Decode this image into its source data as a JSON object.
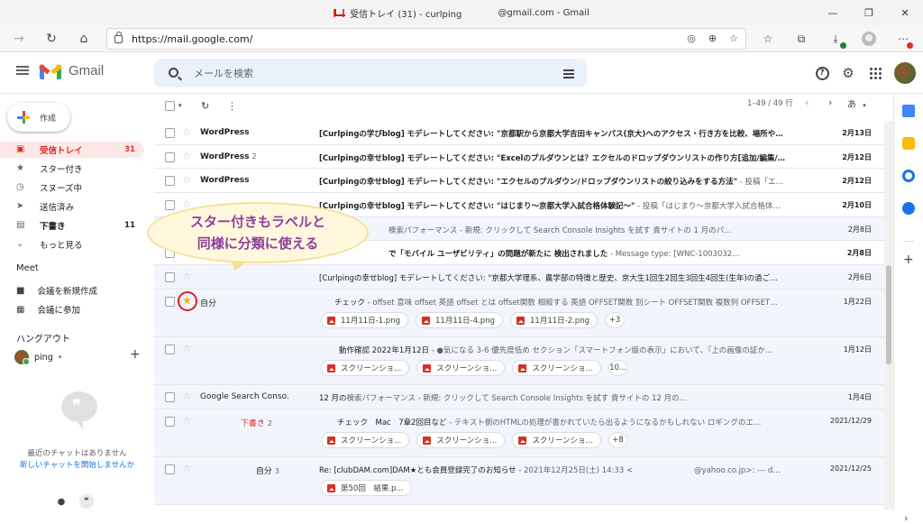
{
  "browser": {
    "window_title_part1": "受信トレイ (31) - curlping",
    "window_title_part2": "@gmail.com - Gmail",
    "url": "https://mail.google.com/"
  },
  "gmail": {
    "brand": "Gmail",
    "search_placeholder": "メールを検索"
  },
  "sidebar": {
    "compose": "作成",
    "items": [
      {
        "label": "受信トレイ",
        "count": "31",
        "icon": "inbox-icon"
      },
      {
        "label": "スター付き",
        "count": "",
        "icon": "star-icon"
      },
      {
        "label": "スヌーズ中",
        "count": "",
        "icon": "clock-icon"
      },
      {
        "label": "送信済み",
        "count": "",
        "icon": "send-icon"
      },
      {
        "label": "下書き",
        "count": "11",
        "icon": "draft-icon"
      },
      {
        "label": "もっと見る",
        "count": "",
        "icon": "expand-icon"
      }
    ],
    "meet_title": "Meet",
    "meet_items": [
      "会議を新規作成",
      "会議に参加"
    ],
    "hangouts_title": "ハングアウト",
    "hangouts_user": "ping",
    "no_chats": "最近のチャットはありません",
    "start_chat": "新しいチャットを開始しませんか"
  },
  "toolbar": {
    "pager": "1–49 / 49 行",
    "lang": "あ"
  },
  "emails": [
    {
      "sender": "WordPress",
      "count": "",
      "draft": "",
      "subject": "[Curlpingの学びblog] モデレートしてください: \"京都駅から京都大学吉田キャンパス(京大)へのアクセス・行き方を比較、場所や…",
      "snippet": "",
      "date": "2月13日",
      "unread": true,
      "starred": false
    },
    {
      "sender": "WordPress",
      "count": "2",
      "draft": "",
      "subject": "[Curlpingの幸せblog] モデレートしてください: \"Excelのプルダウンとは？エクセルのドロップダウンリストの作り方[追加/編集/…",
      "snippet": "",
      "date": "2月12日",
      "unread": true,
      "starred": false
    },
    {
      "sender": "WordPress",
      "count": "",
      "draft": "",
      "subject": "[Curlpingの幸せblog] モデレートしてください: \"エクセルのプルダウン/ドロップダウンリストの絞り込みをする方法\"",
      "snippet": " - 投稿「エ…",
      "date": "2月12日",
      "unread": true,
      "starred": false
    },
    {
      "sender": "",
      "count": "",
      "draft": "",
      "subject": "[Curlpingの幸せblog] モデレートしてください: \"はじまり〜京都大学入試合格体験記〜\"",
      "snippet": " - 投稿「はじまり〜京都大学入試合格体…",
      "date": "2月10日",
      "unread": true,
      "starred": false
    },
    {
      "sender": "",
      "count": "",
      "draft": "",
      "subject": "",
      "snippet": "検索パフォーマンス - 新規: クリックして Search Console Insights を試す 貴サイトの 1 月のパ…",
      "date": "2月8日",
      "unread": false,
      "starred": false
    },
    {
      "sender": "",
      "count": "",
      "draft": "",
      "subject": "で「モバイル ユーザビリティ」の問題が新たに 検出されました",
      "snippet": " - Message type: [WNC-1003032…",
      "date": "2月8日",
      "unread": true,
      "starred": false
    },
    {
      "sender": "",
      "count": "",
      "draft": "",
      "subject": "[Curlpingの幸せblog] モデレートしてください: \"京都大学理系、農学部の特徴と歴史、京大生1回生2回生3回生4回生(生年)の過ご…",
      "snippet": "",
      "date": "2月6日",
      "unread": false,
      "starred": false
    },
    {
      "sender": "自分",
      "count": "",
      "draft": "",
      "subject": "チェック",
      "snippet": " - offset 意味 offset 英語 offset とは offset関数 相殺する 英語 OFFSET関数 別シート OFFSET関数 複数列 OFFSET…",
      "date": "1月22日",
      "unread": false,
      "starred": true,
      "attachments": [
        "11月11日-1.png",
        "11月11日-4.png",
        "11月11日-2.png"
      ],
      "more": "+3"
    },
    {
      "sender": "",
      "count": "",
      "draft": "",
      "subject": "動作確認 2022年1月12日",
      "snippet": " - ●気になる 3-6 優先度低め セクション「スマートフォン版の表示」において、『上の画像の証か…",
      "date": "1月12日",
      "unread": false,
      "starred": false,
      "attachments": [
        "スクリーンショ...",
        "スクリーンショ...",
        "スクリーンショ..."
      ],
      "more": "10..."
    },
    {
      "sender": "Google Search Conso.",
      "count": "",
      "draft": "",
      "subject": "12 月の",
      "snippet": "検索パフォーマンス - 新規: クリックして Search Console Insights を試す 貴サイトの 12 月の…",
      "date": "1月4日",
      "unread": false,
      "starred": false
    },
    {
      "sender": "",
      "count": "2",
      "draft": "下書き",
      "subject": "チェック　Mac　7章2回目など",
      "snippet": " - テキスト側のHTMLの処理が書かれていたら出るようになるかもしれない ロギングのエ…",
      "date": "2021/12/29",
      "unread": false,
      "starred": false,
      "attachments": [
        "スクリーンショ...",
        "スクリーンショ...",
        "スクリーンショ..."
      ],
      "more": "+8"
    },
    {
      "sender": "自分",
      "count": "3",
      "draft": "",
      "subject": "Re: [clubDAM.com]DAM★とも会員登録完了のお知らせ",
      "snippet": " - 2021年12月25日(土) 14:33 <　　　　　　　　@yahoo.co.jp>: --- d…",
      "date": "2021/12/25",
      "unread": false,
      "starred": false,
      "attachments": [
        "第50回　結果.p..."
      ],
      "more": ""
    }
  ],
  "annotation": {
    "line1": "スター付きもラベルと",
    "line2": "同様に分類に使える"
  }
}
